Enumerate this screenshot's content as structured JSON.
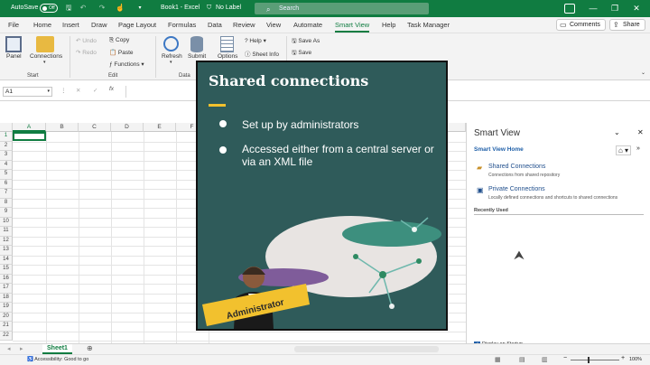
{
  "titlebar": {
    "autosave": "AutoSave",
    "autosave_state": "Off",
    "doc_title": "Book1 - Excel",
    "label_status": "No Label",
    "search_placeholder": "Search"
  },
  "tabs": [
    "File",
    "Home",
    "Insert",
    "Draw",
    "Page Layout",
    "Formulas",
    "Data",
    "Review",
    "View",
    "Automate",
    "Smart View",
    "Help",
    "Task Manager"
  ],
  "active_tab": "Smart View",
  "actions": {
    "comments": "Comments",
    "share": "Share"
  },
  "ribbon": {
    "panel": "Panel",
    "connections": "Connections",
    "undo": "Undo",
    "redo": "Redo",
    "copy": "Copy",
    "paste": "Paste",
    "functions": "Functions",
    "refresh": "Refresh",
    "submit": "Submit",
    "options": "Options",
    "help": "Help",
    "sheet_info": "Sheet Info",
    "save_as": "Save As",
    "save": "Save",
    "group_start": "Start",
    "group_edit": "Edit",
    "group_data": "Data"
  },
  "formula_bar": {
    "cell_ref": "A1"
  },
  "grid": {
    "columns": [
      "A",
      "B",
      "C",
      "D",
      "E",
      "F"
    ],
    "rows": [
      "1",
      "2",
      "3",
      "4",
      "5",
      "6",
      "7",
      "8",
      "9",
      "10",
      "11",
      "12",
      "13",
      "14",
      "15",
      "16",
      "17",
      "18",
      "19",
      "20",
      "21",
      "22"
    ]
  },
  "slide": {
    "title": "Shared connections",
    "bullets": [
      "Set up by administrators",
      "Accessed either from a central server or via an XML file"
    ],
    "banner": "Administrator",
    "colors": {
      "background": "#2f5b5a",
      "accent": "#f2c12e"
    }
  },
  "smart_view": {
    "title": "Smart View",
    "home_link": "Smart View Home",
    "items": [
      {
        "title": "Shared Connections",
        "desc": "Connections from shared repository"
      },
      {
        "title": "Private Connections",
        "desc": "Locally defined connections and shortcuts to shared connections"
      }
    ],
    "recently_used": "Recently Used",
    "display_on_startup": "Display on Startup"
  },
  "sheet_tab": "Sheet1",
  "status": {
    "accessibility": "Accessibility: Good to go",
    "zoom": "100%"
  }
}
